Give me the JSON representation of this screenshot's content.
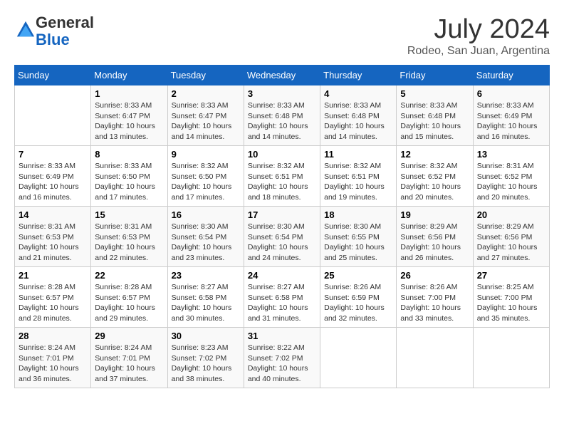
{
  "header": {
    "logo_general": "General",
    "logo_blue": "Blue",
    "month_year": "July 2024",
    "location": "Rodeo, San Juan, Argentina"
  },
  "days_of_week": [
    "Sunday",
    "Monday",
    "Tuesday",
    "Wednesday",
    "Thursday",
    "Friday",
    "Saturday"
  ],
  "weeks": [
    [
      {
        "day": "",
        "info": ""
      },
      {
        "day": "1",
        "info": "Sunrise: 8:33 AM\nSunset: 6:47 PM\nDaylight: 10 hours\nand 13 minutes."
      },
      {
        "day": "2",
        "info": "Sunrise: 8:33 AM\nSunset: 6:47 PM\nDaylight: 10 hours\nand 14 minutes."
      },
      {
        "day": "3",
        "info": "Sunrise: 8:33 AM\nSunset: 6:48 PM\nDaylight: 10 hours\nand 14 minutes."
      },
      {
        "day": "4",
        "info": "Sunrise: 8:33 AM\nSunset: 6:48 PM\nDaylight: 10 hours\nand 14 minutes."
      },
      {
        "day": "5",
        "info": "Sunrise: 8:33 AM\nSunset: 6:48 PM\nDaylight: 10 hours\nand 15 minutes."
      },
      {
        "day": "6",
        "info": "Sunrise: 8:33 AM\nSunset: 6:49 PM\nDaylight: 10 hours\nand 16 minutes."
      }
    ],
    [
      {
        "day": "7",
        "info": "Sunrise: 8:33 AM\nSunset: 6:49 PM\nDaylight: 10 hours\nand 16 minutes."
      },
      {
        "day": "8",
        "info": "Sunrise: 8:33 AM\nSunset: 6:50 PM\nDaylight: 10 hours\nand 17 minutes."
      },
      {
        "day": "9",
        "info": "Sunrise: 8:32 AM\nSunset: 6:50 PM\nDaylight: 10 hours\nand 17 minutes."
      },
      {
        "day": "10",
        "info": "Sunrise: 8:32 AM\nSunset: 6:51 PM\nDaylight: 10 hours\nand 18 minutes."
      },
      {
        "day": "11",
        "info": "Sunrise: 8:32 AM\nSunset: 6:51 PM\nDaylight: 10 hours\nand 19 minutes."
      },
      {
        "day": "12",
        "info": "Sunrise: 8:32 AM\nSunset: 6:52 PM\nDaylight: 10 hours\nand 20 minutes."
      },
      {
        "day": "13",
        "info": "Sunrise: 8:31 AM\nSunset: 6:52 PM\nDaylight: 10 hours\nand 20 minutes."
      }
    ],
    [
      {
        "day": "14",
        "info": "Sunrise: 8:31 AM\nSunset: 6:53 PM\nDaylight: 10 hours\nand 21 minutes."
      },
      {
        "day": "15",
        "info": "Sunrise: 8:31 AM\nSunset: 6:53 PM\nDaylight: 10 hours\nand 22 minutes."
      },
      {
        "day": "16",
        "info": "Sunrise: 8:30 AM\nSunset: 6:54 PM\nDaylight: 10 hours\nand 23 minutes."
      },
      {
        "day": "17",
        "info": "Sunrise: 8:30 AM\nSunset: 6:54 PM\nDaylight: 10 hours\nand 24 minutes."
      },
      {
        "day": "18",
        "info": "Sunrise: 8:30 AM\nSunset: 6:55 PM\nDaylight: 10 hours\nand 25 minutes."
      },
      {
        "day": "19",
        "info": "Sunrise: 8:29 AM\nSunset: 6:56 PM\nDaylight: 10 hours\nand 26 minutes."
      },
      {
        "day": "20",
        "info": "Sunrise: 8:29 AM\nSunset: 6:56 PM\nDaylight: 10 hours\nand 27 minutes."
      }
    ],
    [
      {
        "day": "21",
        "info": "Sunrise: 8:28 AM\nSunset: 6:57 PM\nDaylight: 10 hours\nand 28 minutes."
      },
      {
        "day": "22",
        "info": "Sunrise: 8:28 AM\nSunset: 6:57 PM\nDaylight: 10 hours\nand 29 minutes."
      },
      {
        "day": "23",
        "info": "Sunrise: 8:27 AM\nSunset: 6:58 PM\nDaylight: 10 hours\nand 30 minutes."
      },
      {
        "day": "24",
        "info": "Sunrise: 8:27 AM\nSunset: 6:58 PM\nDaylight: 10 hours\nand 31 minutes."
      },
      {
        "day": "25",
        "info": "Sunrise: 8:26 AM\nSunset: 6:59 PM\nDaylight: 10 hours\nand 32 minutes."
      },
      {
        "day": "26",
        "info": "Sunrise: 8:26 AM\nSunset: 7:00 PM\nDaylight: 10 hours\nand 33 minutes."
      },
      {
        "day": "27",
        "info": "Sunrise: 8:25 AM\nSunset: 7:00 PM\nDaylight: 10 hours\nand 35 minutes."
      }
    ],
    [
      {
        "day": "28",
        "info": "Sunrise: 8:24 AM\nSunset: 7:01 PM\nDaylight: 10 hours\nand 36 minutes."
      },
      {
        "day": "29",
        "info": "Sunrise: 8:24 AM\nSunset: 7:01 PM\nDaylight: 10 hours\nand 37 minutes."
      },
      {
        "day": "30",
        "info": "Sunrise: 8:23 AM\nSunset: 7:02 PM\nDaylight: 10 hours\nand 38 minutes."
      },
      {
        "day": "31",
        "info": "Sunrise: 8:22 AM\nSunset: 7:02 PM\nDaylight: 10 hours\nand 40 minutes."
      },
      {
        "day": "",
        "info": ""
      },
      {
        "day": "",
        "info": ""
      },
      {
        "day": "",
        "info": ""
      }
    ]
  ]
}
